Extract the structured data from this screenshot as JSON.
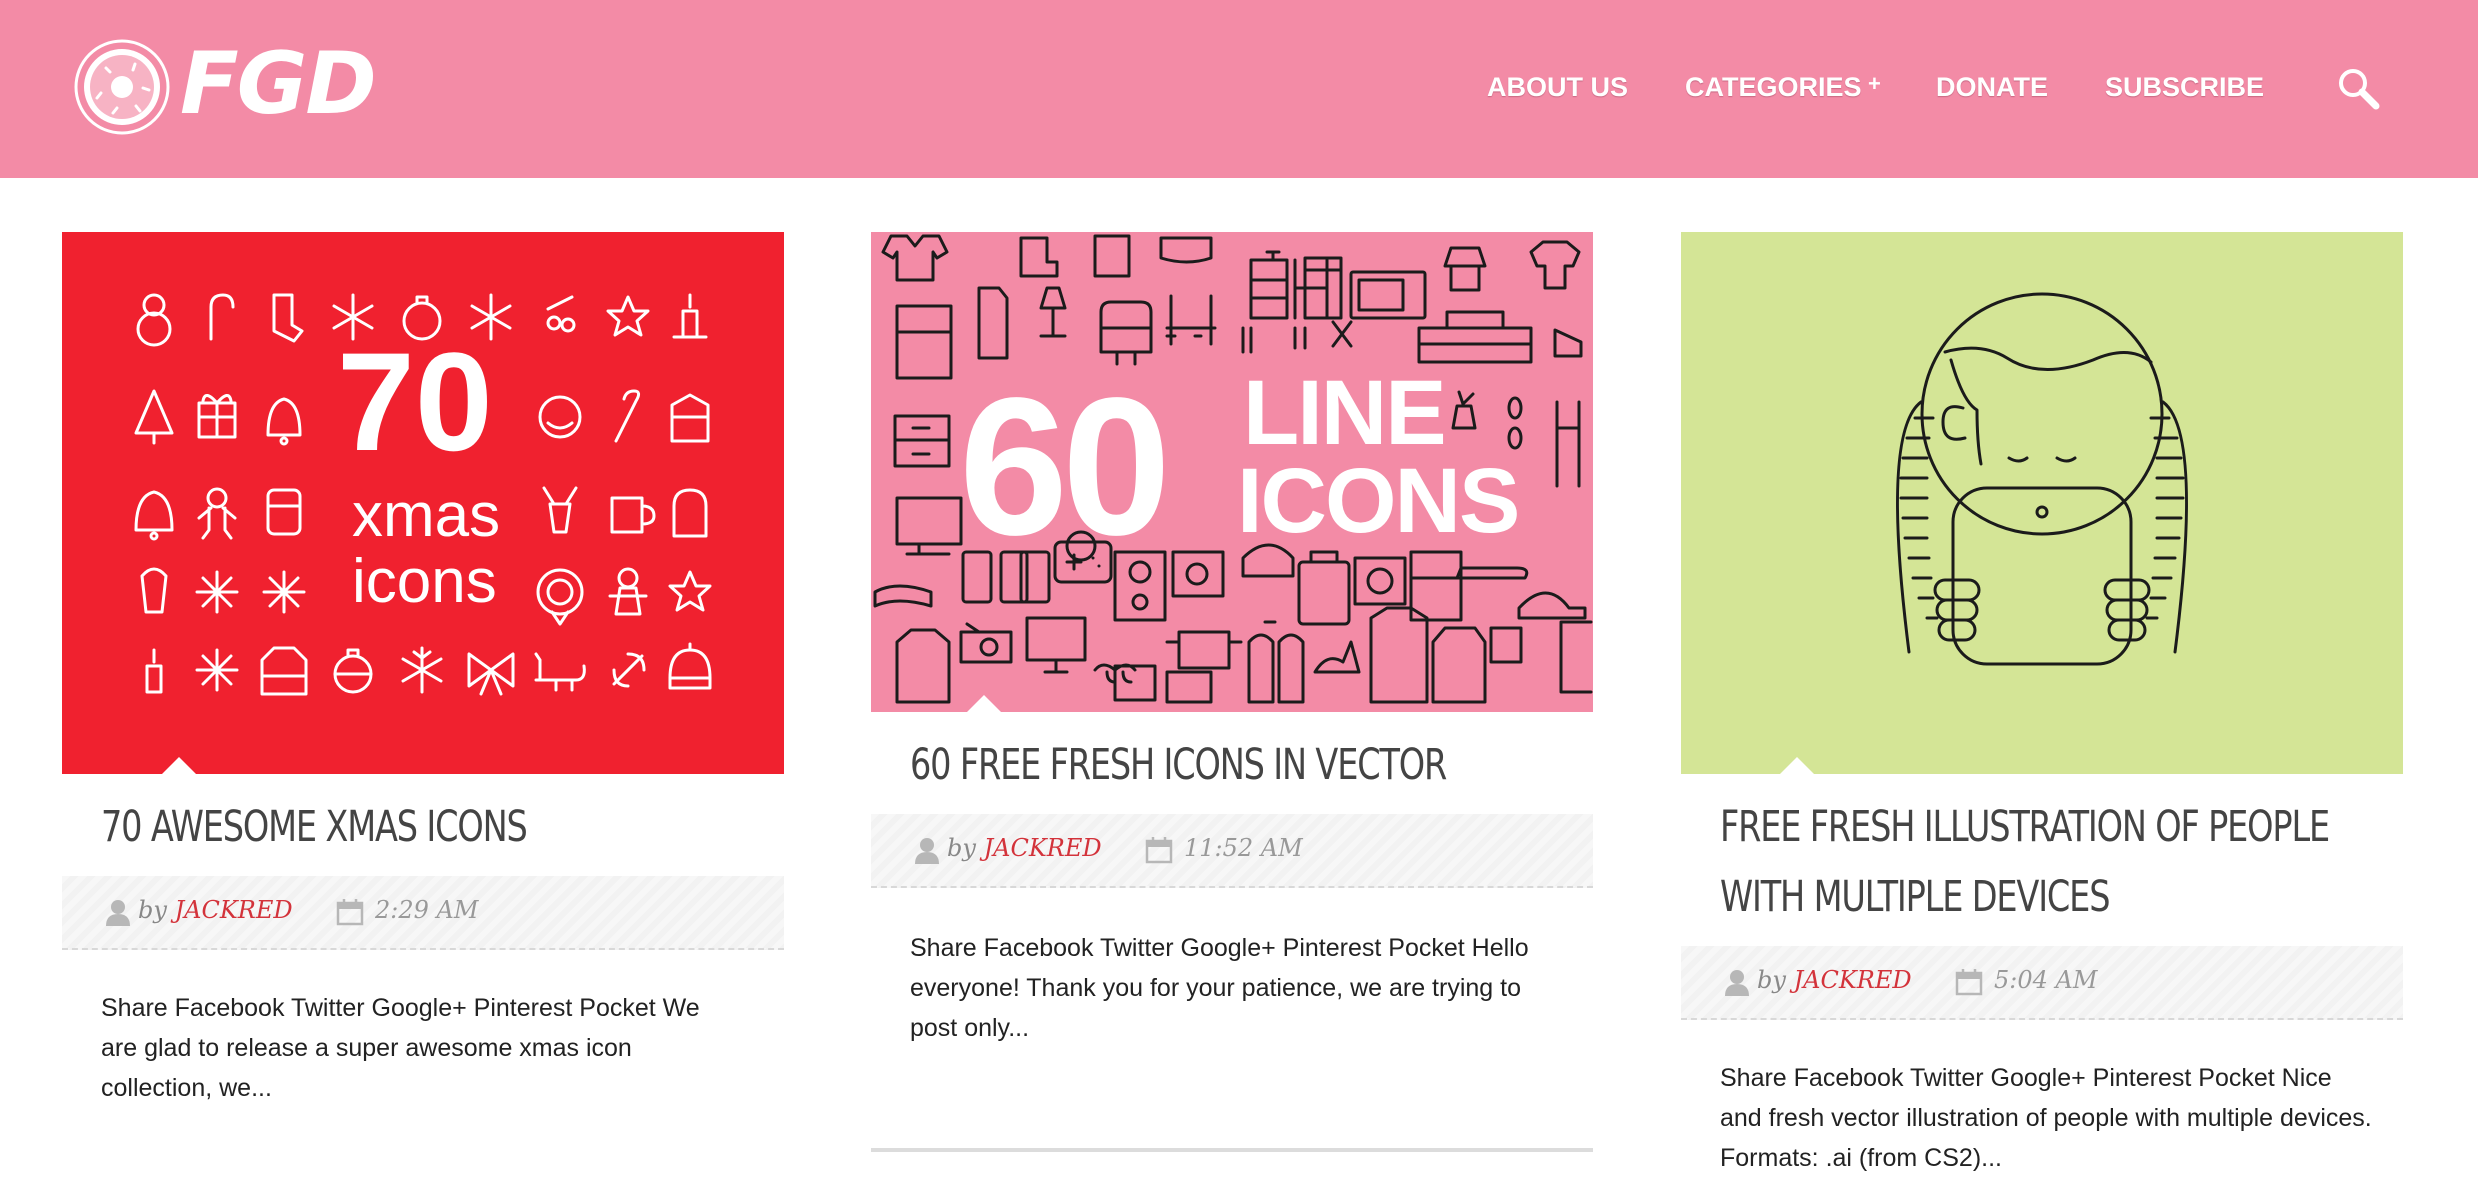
{
  "header": {
    "logo_text": "FGD",
    "nav": [
      {
        "label": "ABOUT US"
      },
      {
        "label": "CATEGORIES"
      },
      {
        "label": "DONATE"
      },
      {
        "label": "SUBSCRIBE"
      }
    ],
    "categories_plus": "+",
    "colors": {
      "bar": "#f38ba6",
      "text": "#ffffff"
    }
  },
  "posts": [
    {
      "image": {
        "number": "70",
        "line1": "xmas",
        "line2": "icons",
        "bg": "#f0212f"
      },
      "title": "70 AWESOME XMAS ICONS",
      "by": "by",
      "author": "JACKRED",
      "time": "2:29 AM",
      "excerpt": "Share Facebook Twitter Google+ Pinterest Pocket We are glad to release a super awesome xmas icon collection, we..."
    },
    {
      "image": {
        "number": "60",
        "line1": "LINE",
        "line2": "ICONS",
        "bg": "#f38ba6"
      },
      "title": "60 FREE FRESH ICONS IN VECTOR",
      "by": "by",
      "author": "JACKRED",
      "time": "11:52 AM",
      "excerpt": "Share Facebook Twitter Google+ Pinterest Pocket Hello everyone! Thank you for your patience, we are trying to post only..."
    },
    {
      "image": {
        "bg": "#d4e596"
      },
      "title_line1": "FREE FRESH ILLUSTRATION OF PEOPLE",
      "title_line2": "WITH MULTIPLE DEVICES",
      "by": "by",
      "author": "JACKRED",
      "time": "5:04 AM",
      "excerpt": "Share Facebook Twitter Google+ Pinterest Pocket Nice and fresh vector illustration of people with multiple devices.  Formats: .ai (from CS2)..."
    }
  ],
  "icons": {
    "logo": "donut-icon",
    "search": "search-icon",
    "author": "user-icon",
    "date": "calendar-icon"
  },
  "accent": "#d3333b"
}
